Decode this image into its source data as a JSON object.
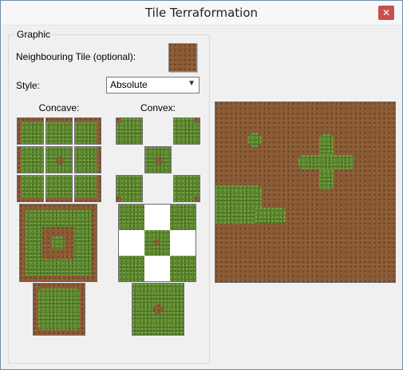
{
  "window": {
    "title": "Tile Terraformation",
    "close_glyph": "✕"
  },
  "group": {
    "title": "Graphic",
    "neighbouring_label": "Neighbouring Tile (optional):",
    "style_label": "Style:",
    "style_value": "Absolute",
    "concave_label": "Concave:",
    "convex_label": "Convex:"
  },
  "colors": {
    "dirt": "#8a5a34",
    "grass": "#5e8a32",
    "close": "#c75050"
  }
}
